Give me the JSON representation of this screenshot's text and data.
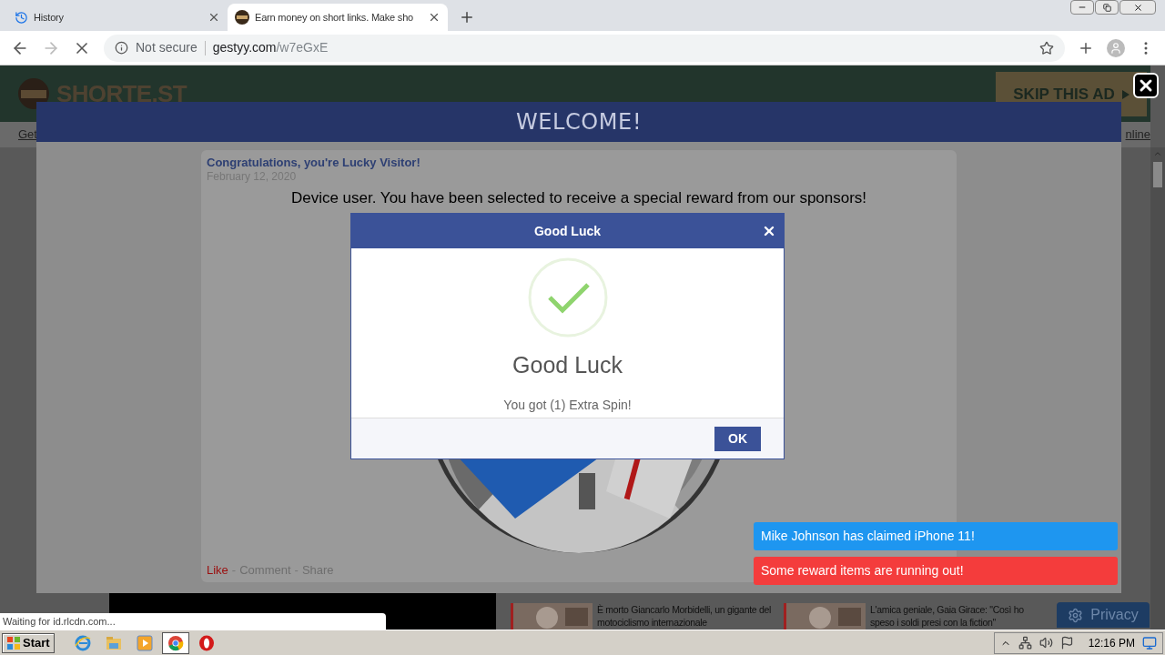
{
  "browser": {
    "tabs": [
      {
        "kind": "history",
        "title": "History",
        "selected": false
      },
      {
        "kind": "site",
        "title": "Earn money on short links. Make sho",
        "selected": true
      }
    ],
    "address": {
      "security": "Not secure",
      "host": "gestyy.com",
      "path": "/w7eGxE"
    }
  },
  "page": {
    "logo": "SHORTE.ST",
    "skip_ad": "SKIP THIS AD",
    "nav_left": "Get",
    "nav_right": "nline",
    "news": [
      {
        "text": "È morto Giancarlo Morbidelli, un gigante del motociclismo internazionale"
      },
      {
        "text": "L'amica geniale, Gaia Girace: \"Così ho speso i soldi presi con la fiction\""
      }
    ],
    "privacy": "Privacy"
  },
  "welcome": {
    "title": "WELCOME!",
    "post_title": "Congratulations, you're Lucky Visitor!",
    "date": "February 12, 2020",
    "message": "Device user. You have been selected to receive a special reward from our sponsors!",
    "separator": "-",
    "actions": [
      {
        "label": "Like",
        "highlighted": true
      },
      {
        "label": "Comment",
        "highlighted": false
      },
      {
        "label": "Share",
        "highlighted": false
      }
    ]
  },
  "dialog": {
    "title": "Good Luck",
    "heading": "Good Luck",
    "message": "You got (1) Extra Spin!",
    "button": "OK"
  },
  "notifications": [
    {
      "text": "Mike Johnson has claimed iPhone 11!",
      "color": "#1e96f0"
    },
    {
      "text": "Some reward items are running out!",
      "color": "#f43c3c"
    }
  ],
  "status_text": "Waiting for id.rlcdn.com...",
  "taskbar": {
    "start": "Start",
    "apps": [
      {
        "kind": "ie",
        "selected": false
      },
      {
        "kind": "explorer",
        "selected": false
      },
      {
        "kind": "media",
        "selected": false
      },
      {
        "kind": "chrome",
        "selected": true
      },
      {
        "kind": "opera",
        "selected": false
      }
    ],
    "clock": "12:16 PM"
  }
}
